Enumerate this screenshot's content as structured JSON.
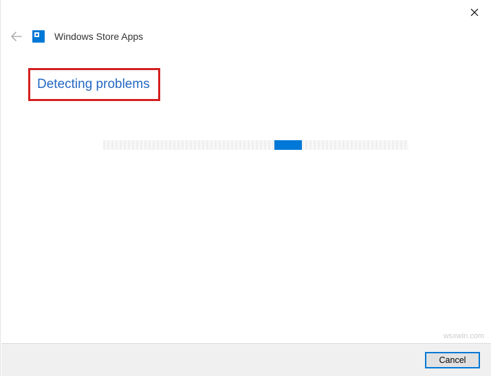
{
  "header": {
    "title": "Windows Store Apps"
  },
  "main": {
    "status": "Detecting problems"
  },
  "footer": {
    "cancel_label": "Cancel"
  },
  "watermark": "wsxwin.com"
}
